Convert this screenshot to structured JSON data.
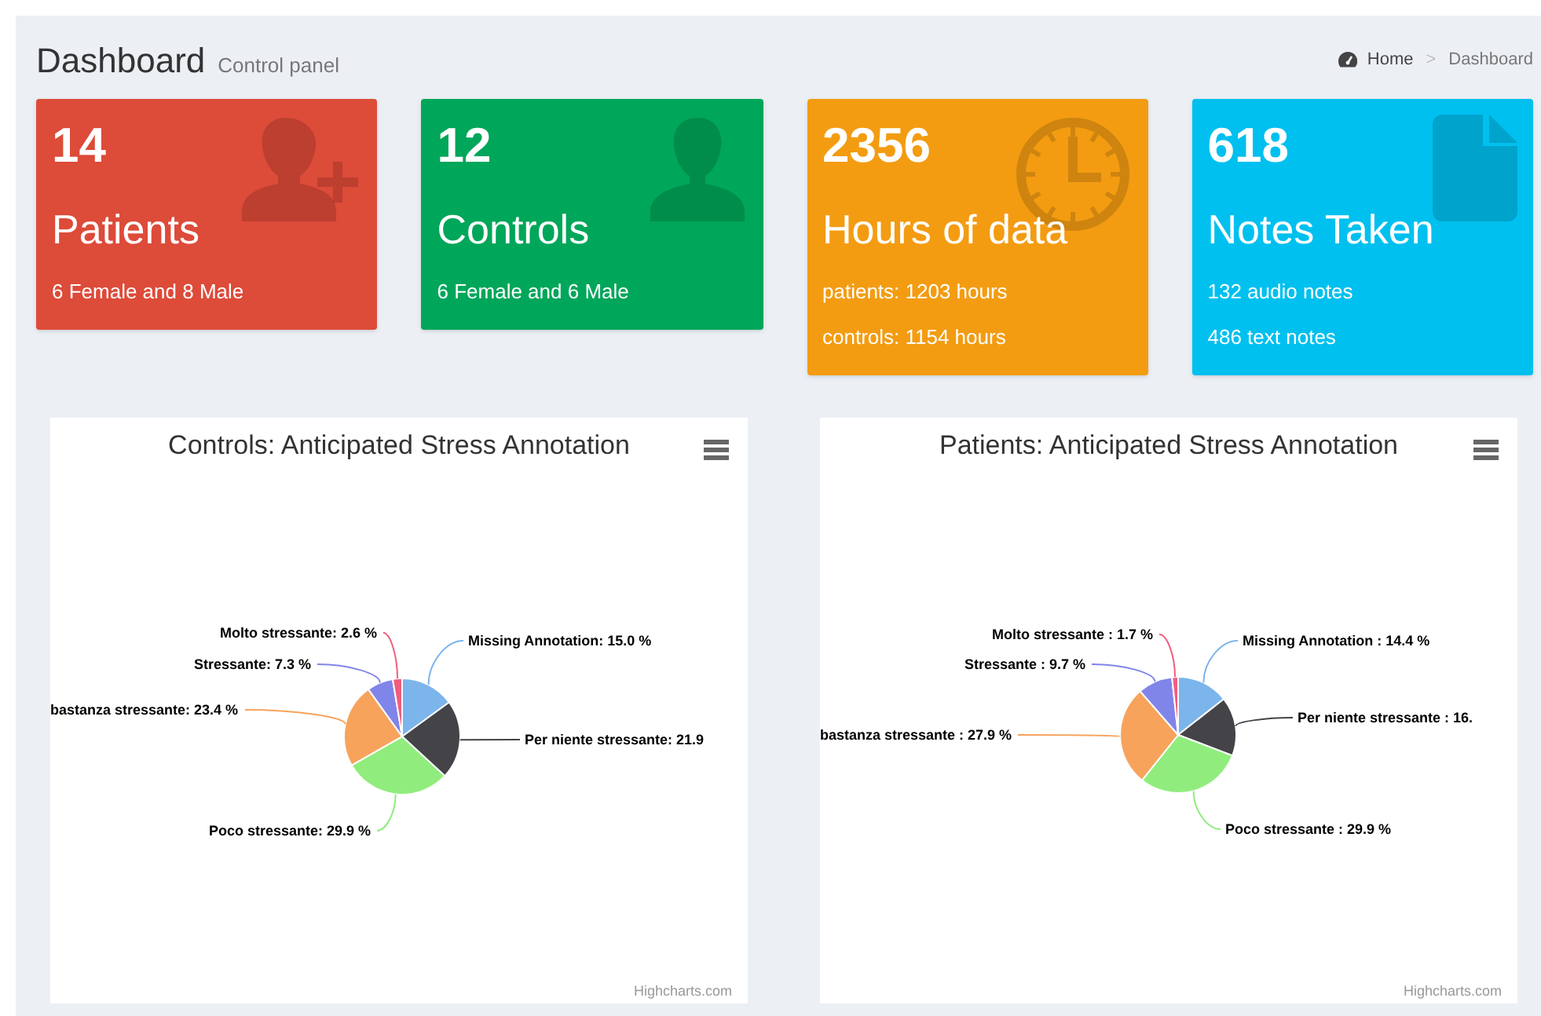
{
  "header": {
    "title": "Dashboard",
    "subtitle": "Control panel"
  },
  "breadcrumb": {
    "items": [
      "Home",
      "Dashboard"
    ],
    "separator": ">"
  },
  "cards": [
    {
      "value": "14",
      "title": "Patients",
      "lines": [
        "6 Female and 8 Male"
      ],
      "color": "#dd4b39",
      "kind": "useradd"
    },
    {
      "value": "12",
      "title": "Controls",
      "lines": [
        "6 Female and 6 Male"
      ],
      "color": "#00a65a",
      "kind": "user"
    },
    {
      "value": "2356",
      "title": "Hours of data",
      "lines": [
        "patients: 1203 hours",
        "controls: 1154 hours"
      ],
      "color": "#f39c12",
      "kind": "clock"
    },
    {
      "value": "618",
      "title": "Notes Taken",
      "lines": [
        "132 audio notes",
        "486 text notes"
      ],
      "color": "#00c0ef",
      "kind": "file"
    }
  ],
  "charts": [
    {
      "credit": "Highcharts.com",
      "chart_data": {
        "type": "pie",
        "title": "Controls: Anticipated Stress Annotation",
        "categories": [
          "Missing Annotation: 15.0 %",
          "Per niente stressante: 21.9",
          "Poco stressante: 29.9 %",
          "bastanza stressante: 23.4 %",
          "Stressante: 7.3 %",
          "Molto stressante: 2.6 %"
        ],
        "series": [
          {
            "values": [
              15.0,
              21.9,
              29.9,
              23.4,
              7.3,
              2.6
            ]
          }
        ]
      }
    },
    {
      "credit": "Highcharts.com",
      "chart_data": {
        "type": "pie",
        "title": "Patients: Anticipated Stress Annotation",
        "categories": [
          "Missing Annotation : 14.4 %",
          "Per niente stressante : 16.",
          "Poco stressante : 29.9 %",
          "bastanza stressante : 27.9 %",
          "Stressante : 9.7 %",
          "Molto stressante : 1.7 %"
        ],
        "series": [
          {
            "values": [
              14.4,
              16.4,
              29.9,
              27.9,
              9.7,
              1.7
            ]
          }
        ]
      }
    }
  ]
}
